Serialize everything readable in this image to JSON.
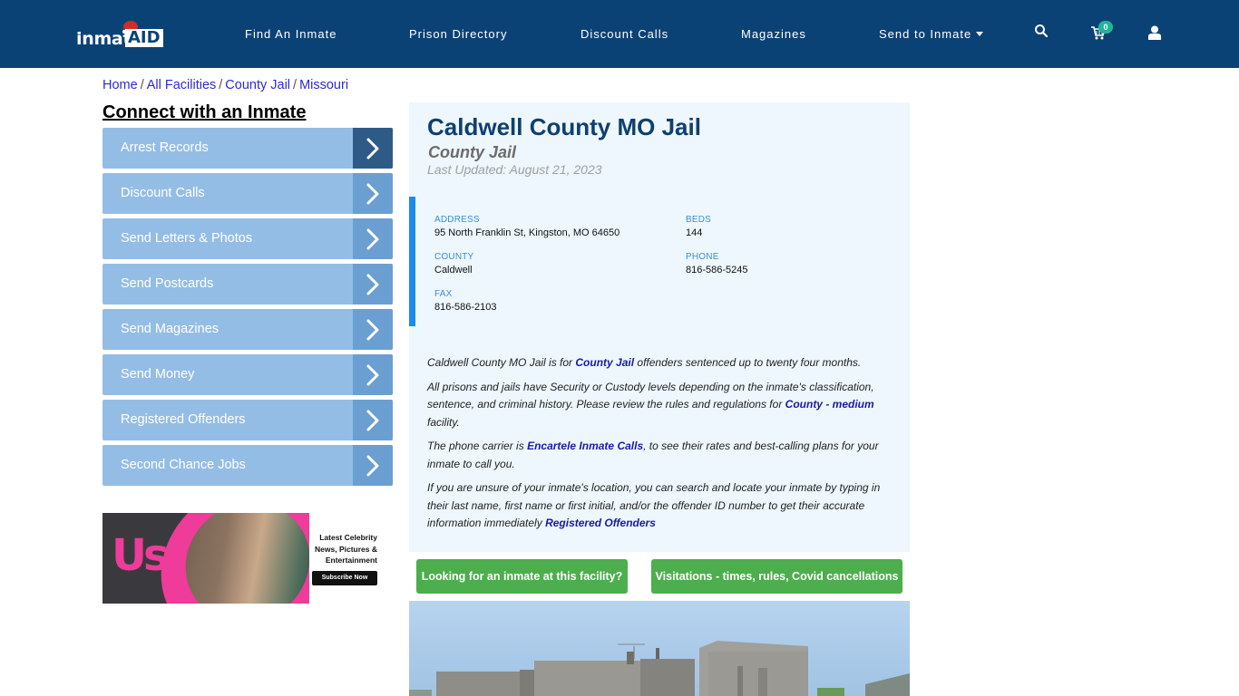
{
  "header": {
    "logo": {
      "text": "inmate",
      "accent": "AID"
    },
    "nav": [
      {
        "label": "Find An Inmate"
      },
      {
        "label": "Prison Directory"
      },
      {
        "label": "Discount Calls"
      },
      {
        "label": "Magazines"
      },
      {
        "label": "Send to Inmate"
      }
    ],
    "cart_count": "0",
    "icons": [
      "search-icon",
      "cart-icon",
      "user-icon"
    ]
  },
  "breadcrumb": [
    {
      "label": "Home"
    },
    {
      "label": "All Facilities"
    },
    {
      "label": "County Jail"
    },
    {
      "label": "Missouri"
    }
  ],
  "breadcrumb_separator": "/",
  "sidebar": {
    "title": "Connect with an Inmate",
    "items": [
      {
        "label": "Arrest Records",
        "active": true
      },
      {
        "label": "Discount Calls"
      },
      {
        "label": "Send Letters & Photos"
      },
      {
        "label": "Send Postcards"
      },
      {
        "label": "Send Magazines"
      },
      {
        "label": "Send Money"
      },
      {
        "label": "Registered Offenders"
      },
      {
        "label": "Second Chance Jobs"
      }
    ]
  },
  "ad": {
    "brand": "Us",
    "tagline": [
      "Latest Celebrity",
      "News, Pictures &",
      "Entertainment"
    ],
    "cta": "Subscribe Now"
  },
  "facility": {
    "name": "Caldwell County MO Jail",
    "type": "County Jail",
    "last_updated": "Last Updated: August 21, 2023",
    "fields": {
      "address": {
        "label": "ADDRESS",
        "value": "95 North Franklin St, Kingston, MO 64650"
      },
      "beds": {
        "label": "BEDS",
        "value": "144"
      },
      "county": {
        "label": "COUNTY",
        "value": "Caldwell"
      },
      "phone": {
        "label": "PHONE",
        "value": "816-586-5245"
      },
      "fax": {
        "label": "FAX",
        "value": "816-586-2103"
      }
    },
    "description": {
      "p1_a": "Caldwell County MO Jail is for ",
      "p1_link": "County Jail",
      "p1_b": " offenders sentenced up to twenty four months.",
      "p2_a": "All prisons and jails have Security or Custody levels depending on the inmate's classification, sentence, and criminal history. Please review the rules and regulations for ",
      "p2_link": "County - medium",
      "p2_b": " facility.",
      "p3_a": "The phone carrier is ",
      "p3_link": "Encartele Inmate Calls",
      "p3_b": ", to see their rates and best-calling plans for your inmate to call you.",
      "p4_a": "If you are unsure of your inmate's location, you can search and locate your inmate by typing in their last name, first name or first initial, and/or the offender ID number to get their accurate information immediately ",
      "p4_link": "Registered Offenders"
    }
  },
  "buttons": {
    "find_inmate": "Looking for an inmate at this facility?",
    "visitations": "Visitations - times, rules, Covid cancellations"
  },
  "colors": {
    "header_bg": "#0b4276",
    "sidebar_item": "#94bde6",
    "sidebar_arrow": "#6b9fd1",
    "sidebar_arrow_active": "#2e5a87",
    "card_bg": "#edf7fd",
    "accent_bar": "#1a8be8",
    "button_green": "#4cae4c",
    "badge": "#23b39a"
  }
}
